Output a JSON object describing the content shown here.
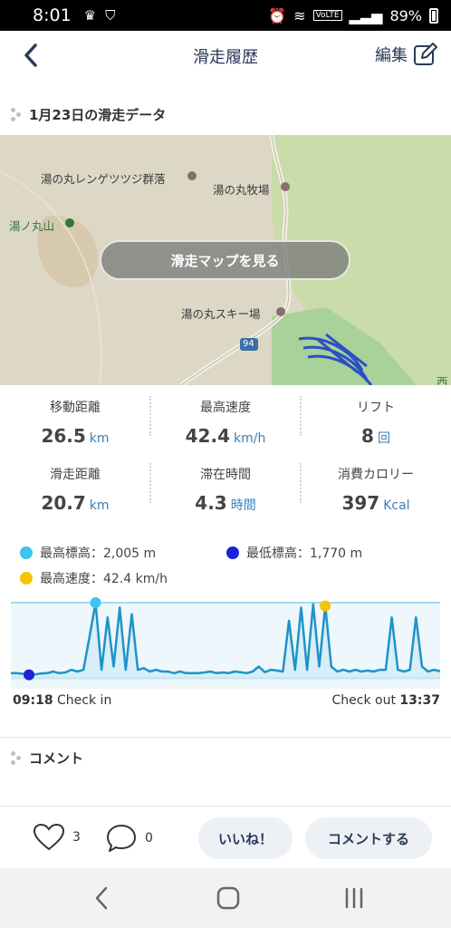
{
  "status_bar": {
    "time": "8:01",
    "battery": "89%",
    "volte": "VoLTE"
  },
  "header": {
    "title": "滑走履歴",
    "edit_label": "編集"
  },
  "session": {
    "title": "1月23日の滑走データ"
  },
  "map": {
    "labels": [
      "湯の丸レンゲツツジ群落",
      "湯の丸牧場",
      "湯ノ丸山",
      "湯の丸スキー場",
      "94",
      "西"
    ],
    "button_label": "滑走マップを見る"
  },
  "stats": [
    {
      "label": "移動距離",
      "value": "26.5",
      "unit": "km"
    },
    {
      "label": "最高速度",
      "value": "42.4",
      "unit": "km/h"
    },
    {
      "label": "リフト",
      "value": "8",
      "unit": "回"
    },
    {
      "label": "滑走距離",
      "value": "20.7",
      "unit": "km"
    },
    {
      "label": "滞在時間",
      "value": "4.3",
      "unit": "時間"
    },
    {
      "label": "消費カロリー",
      "value": "397",
      "unit": "Kcal"
    }
  ],
  "legend": {
    "max_elev": "最高標高：2,005 m",
    "min_elev": "最低標高：1,770 m",
    "max_speed": "最高速度：42.4 km/h"
  },
  "colors": {
    "max_elev": "#3cc3f0",
    "min_elev": "#1a23d6",
    "max_speed": "#f5c400",
    "line": "#1f93c7",
    "accent": "#3a7fb8"
  },
  "chart_data": {
    "type": "line",
    "x": [
      "09:18",
      "13:37"
    ],
    "ylim": [
      1770,
      2005
    ],
    "series": [
      {
        "values": [
          1790,
          1790,
          1788,
          1785,
          1786,
          1789,
          1790,
          1795,
          1790,
          1792,
          1800,
          1795,
          1800,
          1900,
          2005,
          1800,
          1960,
          1810,
          1990,
          1800,
          1970,
          1800,
          1805,
          1795,
          1800,
          1795,
          1795,
          1790,
          1795,
          1790,
          1790,
          1790,
          1792,
          1795,
          1790,
          1792,
          1790,
          1795,
          1793,
          1790,
          1795,
          1810,
          1793,
          1800,
          1798,
          1795,
          1950,
          1800,
          1990,
          1800,
          2000,
          1810,
          1995,
          1810,
          1795,
          1800,
          1795,
          1800,
          1795,
          1798,
          1795,
          1800,
          1800,
          1960,
          1800,
          1795,
          1800,
          1960,
          1810,
          1795,
          1800,
          1796
        ]
      }
    ]
  },
  "check_in": {
    "time": "09:18",
    "label": "Check in"
  },
  "check_out": {
    "time": "13:37",
    "label": "Check out"
  },
  "comment_section": {
    "title": "コメント"
  },
  "actions": {
    "like_count": "3",
    "comment_count": "0",
    "like_button": "いいね！",
    "comment_button": "コメントする"
  }
}
